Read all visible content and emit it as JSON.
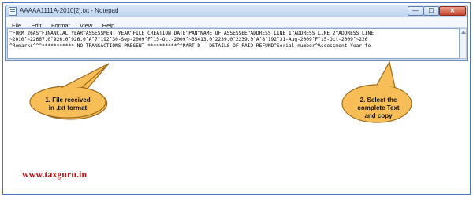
{
  "window": {
    "title": "AAAAA1111A-2010[2].txt - Notepad",
    "minimize_glyph": "—",
    "maximize_glyph": "☐",
    "close_glyph": "✕"
  },
  "menu": {
    "items": [
      "File",
      "Edit",
      "Format",
      "View",
      "Help"
    ]
  },
  "editor": {
    "lines": [
      "^FORM 26AS^FINANCIAL YEAR^ASSESSMENT YEAR^FILE CREATION DATE^PAN^NAME OF ASSESSEE^ADDRESS LINE 1^ADDRESS LINE 2^ADDRESS LINE",
      "~2010^~22667.0^926.0^926.0^A^7^192^30-Sep-2009^F^15-Oct-2009^~35413.0^2239.0^2239.0^A^8^192^31-Aug-2009^F^15-Oct-2009^~226",
      "^Remarks^^^*********** NO TRANSACTIONS PRESENT **********^^PART D - DETAILS OF PAID REFUND^Serial number^Assessment Year fo"
    ]
  },
  "callouts": {
    "first": {
      "line1": "1. File received",
      "line2": "in .txt format"
    },
    "second": {
      "line1": "2. Select the",
      "line2": "complete Text",
      "line3": "and copy"
    }
  },
  "footer": {
    "site": "www.taxguru.in"
  },
  "colors": {
    "callout_fill": "#f7be57",
    "callout_stroke": "#9c6a1e",
    "site_text": "#c0151a",
    "frame_border": "#4a78b8"
  }
}
